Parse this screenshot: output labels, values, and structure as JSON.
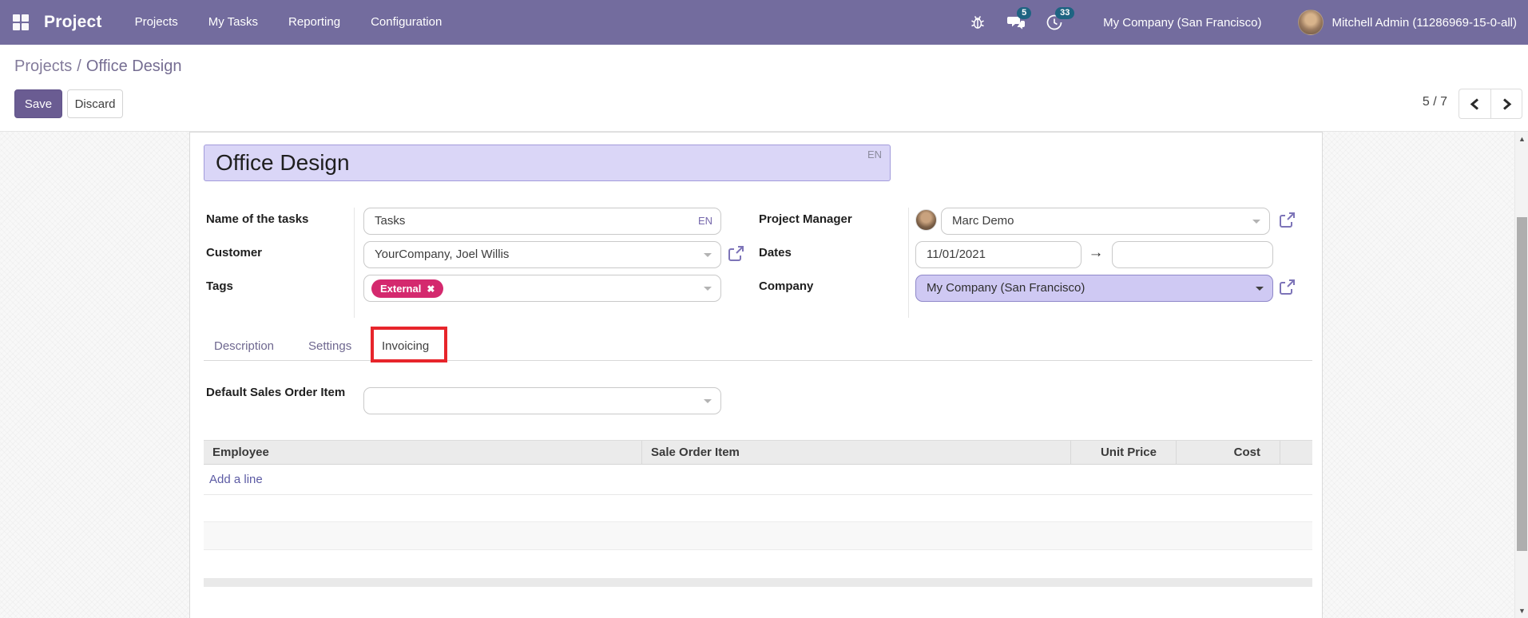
{
  "navbar": {
    "brand": "Project",
    "menus": [
      "Projects",
      "My Tasks",
      "Reporting",
      "Configuration"
    ],
    "messages_count": "5",
    "activities_count": "33",
    "company": "My Company (San Francisco)",
    "user": "Mitchell Admin (11286969-15-0-all)"
  },
  "breadcrumb": {
    "parent": "Projects",
    "separator": "/",
    "current": "Office Design"
  },
  "control_panel": {
    "save": "Save",
    "discard": "Discard",
    "pager": "5 / 7"
  },
  "form": {
    "title": {
      "value": "Office Design",
      "lang_badge": "EN"
    },
    "fields": {
      "task_name": {
        "label": "Name of the tasks",
        "value": "Tasks",
        "lang_badge": "EN"
      },
      "customer": {
        "label": "Customer",
        "value": "YourCompany, Joel Willis"
      },
      "tags": {
        "label": "Tags",
        "tag": "External",
        "remove": "✖"
      },
      "project_manager": {
        "label": "Project Manager",
        "value": "Marc Demo"
      },
      "dates": {
        "label": "Dates",
        "start": "11/01/2021",
        "end": "",
        "arrow": "→"
      },
      "company": {
        "label": "Company",
        "value": "My Company (San Francisco)"
      }
    },
    "tabs": [
      {
        "label": "Description"
      },
      {
        "label": "Settings"
      },
      {
        "label": "Invoicing"
      }
    ],
    "invoicing_tab": {
      "default_item_label": "Default Sales Order Item",
      "table": {
        "headers": [
          "Employee",
          "Sale Order Item",
          "Unit Price",
          "Cost"
        ],
        "add_line": "Add a line"
      }
    }
  },
  "colors": {
    "navbar_bg": "#736C9E",
    "badge_bg": "#1E6482",
    "save_button": "#6A5C92",
    "tag_pill": "#D4296E",
    "title_highlight": "#DAD6F7",
    "company_highlight": "#CFC9F3",
    "annotation_red": "#E7252B",
    "add_line_link": "#5C5BA4"
  },
  "scrollbar": {
    "up": "▲",
    "down": "▼"
  }
}
